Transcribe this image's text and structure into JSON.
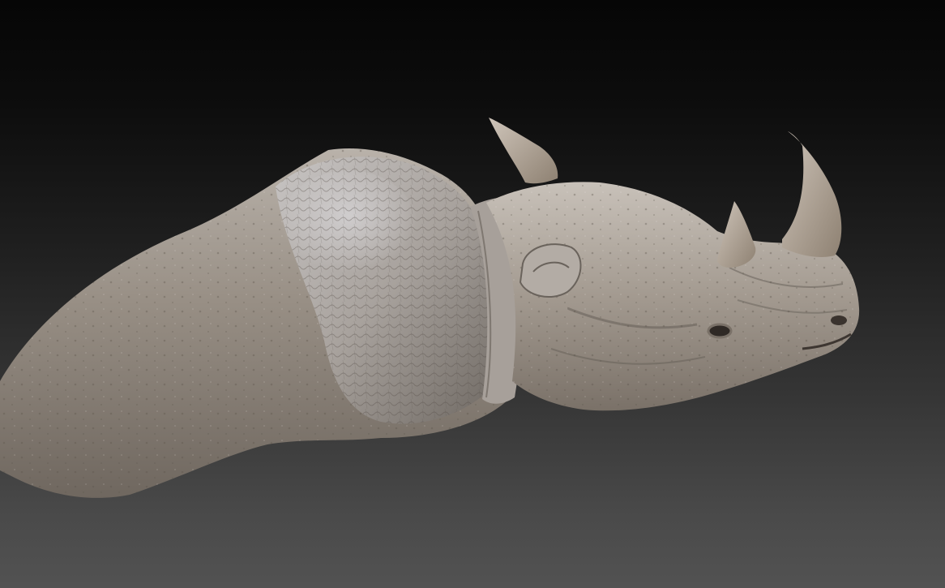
{
  "viewport": {
    "background_top": "#060606",
    "background_bottom": "#525252"
  },
  "model": {
    "subject_icon": "rhino-head-sculpt",
    "skin_base": "#9c958c",
    "skin_light": "#c9c6c4",
    "skin_dark": "#5c554e",
    "horn_color": "#a8998a"
  }
}
